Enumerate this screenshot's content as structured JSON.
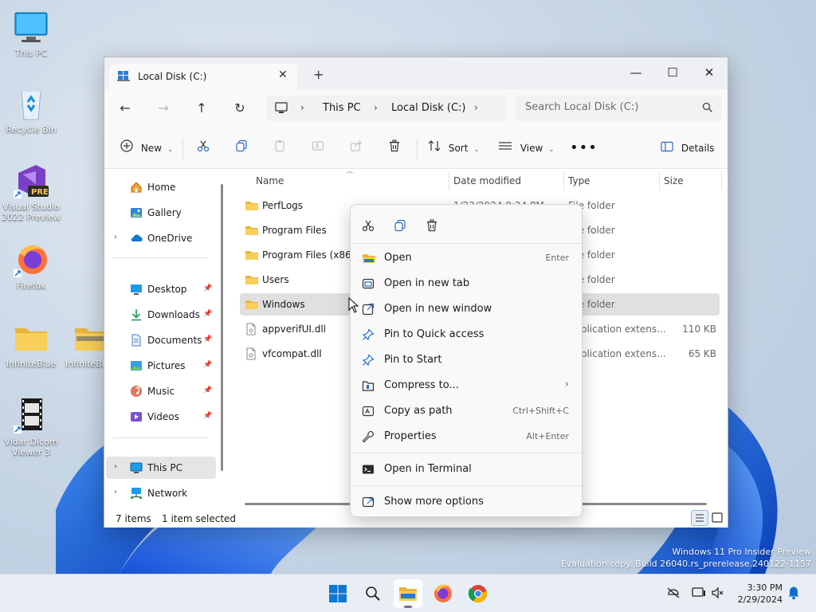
{
  "desktop": {
    "icons": [
      {
        "label": "This PC"
      },
      {
        "label": "Recycle Bin"
      },
      {
        "label": "Visual Studio 2022 Preview",
        "badge": "PRE"
      },
      {
        "label": "Firefox"
      },
      {
        "label": "InfiniteBlue"
      },
      {
        "label": "InfiniteBl"
      },
      {
        "label": "Vidar Dicom Viewer 3"
      }
    ],
    "watermark": {
      "line1": "Windows 11 Pro Insider Preview",
      "line2": "Evaluation copy. Build 26040.rs_prerelease.240122-1157"
    }
  },
  "window": {
    "tab_title": "Local Disk (C:)",
    "breadcrumb": [
      "This PC",
      "Local Disk (C:)"
    ],
    "search_placeholder": "Search Local Disk (C:)",
    "commands": {
      "new": "New",
      "sort": "Sort",
      "view": "View",
      "details": "Details"
    },
    "nav": {
      "items": [
        {
          "label": "Home"
        },
        {
          "label": "Gallery"
        },
        {
          "label": "OneDrive"
        },
        {
          "label": "Desktop"
        },
        {
          "label": "Downloads"
        },
        {
          "label": "Documents"
        },
        {
          "label": "Pictures"
        },
        {
          "label": "Music"
        },
        {
          "label": "Videos"
        },
        {
          "label": "This PC"
        },
        {
          "label": "Network"
        }
      ]
    },
    "columns": {
      "name": "Name",
      "date": "Date modified",
      "type": "Type",
      "size": "Size"
    },
    "files": [
      {
        "name": "PerfLogs",
        "date": "1/22/2024 8:24 PM",
        "type": "File folder",
        "size": ""
      },
      {
        "name": "Program Files",
        "date": "",
        "type": "File folder",
        "size": ""
      },
      {
        "name": "Program Files (x86)",
        "date": "",
        "type": "File folder",
        "size": ""
      },
      {
        "name": "Users",
        "date": "",
        "type": "File folder",
        "size": ""
      },
      {
        "name": "Windows",
        "date": "",
        "type": "File folder",
        "size": ""
      },
      {
        "name": "appverifUI.dll",
        "date": "",
        "type": "Application extens...",
        "size": "110 KB"
      },
      {
        "name": "vfcompat.dll",
        "date": "",
        "type": "Application extens...",
        "size": "65 KB"
      }
    ],
    "status": {
      "count": "7 items",
      "selected": "1 item selected"
    }
  },
  "context_menu": {
    "items": [
      {
        "label": "Open",
        "key": "Enter"
      },
      {
        "label": "Open in new tab",
        "key": ""
      },
      {
        "label": "Open in new window",
        "key": ""
      },
      {
        "label": "Pin to Quick access",
        "key": ""
      },
      {
        "label": "Pin to Start",
        "key": ""
      },
      {
        "label": "Compress to...",
        "key": ""
      },
      {
        "label": "Copy as path",
        "key": "Ctrl+Shift+C"
      },
      {
        "label": "Properties",
        "key": "Alt+Enter"
      },
      {
        "label": "Open in Terminal",
        "key": ""
      },
      {
        "label": "Show more options",
        "key": ""
      }
    ]
  },
  "taskbar": {
    "time": "3:30 PM",
    "date": "2/29/2024"
  },
  "colors": {
    "accent": "#0067c0",
    "folder": "#f5c542",
    "taskbar": "#e9eef4"
  }
}
